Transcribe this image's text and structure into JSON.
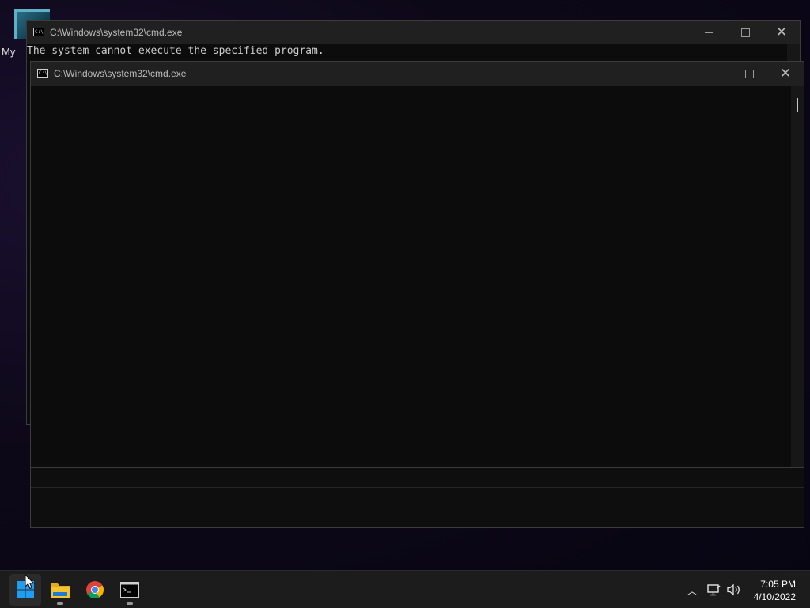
{
  "desktop": {
    "icon_label": "My"
  },
  "back_window": {
    "title": "C:\\Windows\\system32\\cmd.exe",
    "console_text": "The system cannot execute the specified program.",
    "icon_text": "C:\\"
  },
  "front_window": {
    "title": "C:\\Windows\\system32\\cmd.exe",
    "icon_text": "C:\\",
    "console_text": ""
  },
  "title_controls": {
    "close_glyph": "✕"
  },
  "taskbar": {
    "apps": [
      {
        "name": "Start",
        "icon": "windows-logo-icon"
      },
      {
        "name": "File Explorer",
        "icon": "folder-icon"
      },
      {
        "name": "Google Chrome",
        "icon": "chrome-icon"
      },
      {
        "name": "Command Prompt",
        "icon": "terminal-icon"
      }
    ],
    "tray": {
      "chevron_glyph": "︿"
    },
    "clock": {
      "time": "7:05 PM",
      "date": "4/10/2022"
    }
  },
  "colors": {
    "console_bg": "#0c0c0c",
    "titlebar_bg": "#202020",
    "taskbar_bg": "#1c1c1c",
    "start_blue": "#1f9df0",
    "folder_yellow": "#f4c430"
  }
}
